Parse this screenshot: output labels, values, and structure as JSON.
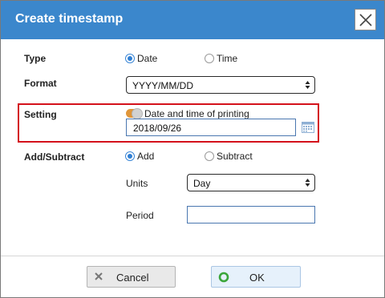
{
  "dialog": {
    "title": "Create timestamp",
    "close_icon": "close-icon"
  },
  "type": {
    "label": "Type",
    "options": [
      {
        "label": "Date",
        "selected": true
      },
      {
        "label": "Time",
        "selected": false
      }
    ]
  },
  "format": {
    "label": "Format",
    "selected": "YYYY/MM/DD"
  },
  "setting": {
    "label": "Setting",
    "toggle_label": "Date and time of printing",
    "toggle_on": true,
    "date_value": "2018/09/26",
    "calendar_icon": "calendar-icon"
  },
  "add_subtract": {
    "label": "Add/Subtract",
    "options": [
      {
        "label": "Add",
        "selected": true
      },
      {
        "label": "Subtract",
        "selected": false
      }
    ],
    "units_label": "Units",
    "units_selected": "Day",
    "period_label": "Period",
    "period_value": ""
  },
  "footer": {
    "cancel_label": "Cancel",
    "ok_label": "OK"
  },
  "colors": {
    "titlebar": "#3b87cc",
    "highlight": "#d4111b",
    "toggle": "#e0963a",
    "ok_icon": "#3aa63a"
  }
}
